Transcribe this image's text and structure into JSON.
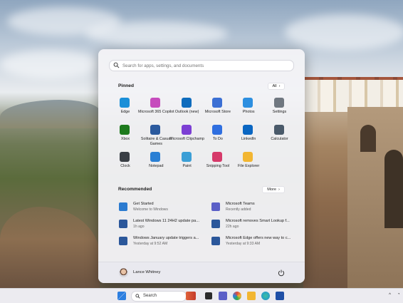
{
  "search": {
    "placeholder": "Search for apps, settings, and documents"
  },
  "pinned": {
    "title": "Pinned",
    "all_label": "All",
    "apps": [
      {
        "label": "Edge",
        "icon": "edge-icon",
        "color": "#1a8fd8"
      },
      {
        "label": "Microsoft 365 Copilot",
        "icon": "m365-copilot-icon",
        "color": "#c64bbd"
      },
      {
        "label": "Outlook (new)",
        "icon": "outlook-icon",
        "color": "#0f6cbd"
      },
      {
        "label": "Microsoft Store",
        "icon": "store-icon",
        "color": "#3b6fd4"
      },
      {
        "label": "Photos",
        "icon": "photos-icon",
        "color": "#2d8fe0"
      },
      {
        "label": "Settings",
        "icon": "settings-icon",
        "color": "#6f7780"
      },
      {
        "label": "Xbox",
        "icon": "xbox-icon",
        "color": "#1d7a1d"
      },
      {
        "label": "Solitaire & Casual Games",
        "icon": "solitaire-icon",
        "color": "#2b5a9e"
      },
      {
        "label": "Microsoft Clipchamp",
        "icon": "clipchamp-icon",
        "color": "#7c3fd4"
      },
      {
        "label": "To Do",
        "icon": "todo-icon",
        "color": "#2f6fe0"
      },
      {
        "label": "LinkedIn",
        "icon": "linkedin-icon",
        "color": "#0a66c2"
      },
      {
        "label": "Calculator",
        "icon": "calculator-icon",
        "color": "#4a5a6a"
      },
      {
        "label": "Clock",
        "icon": "clock-icon",
        "color": "#3a3f45"
      },
      {
        "label": "Notepad",
        "icon": "notepad-icon",
        "color": "#2a7fd4"
      },
      {
        "label": "Paint",
        "icon": "paint-icon",
        "color": "#3b9fd6"
      },
      {
        "label": "Snipping Tool",
        "icon": "snipping-tool-icon",
        "color": "#d63a6a"
      },
      {
        "label": "File Explorer",
        "icon": "file-explorer-icon",
        "color": "#f2b632"
      }
    ]
  },
  "recommended": {
    "title": "Recommended",
    "more_label": "More",
    "items": [
      {
        "title": "Get Started",
        "subtitle": "Welcome to Windows",
        "icon": "get-started-icon",
        "color": "#2b7bd0"
      },
      {
        "title": "Microsoft Teams",
        "subtitle": "Recently added",
        "icon": "teams-icon",
        "color": "#5b5fc7"
      },
      {
        "title": "Latest Windows 11 24H2 update pa...",
        "subtitle": "1h ago",
        "icon": "word-doc-icon",
        "color": "#2b579a"
      },
      {
        "title": "Microsoft removes Smart Lookup f...",
        "subtitle": "22h ago",
        "icon": "word-doc-icon",
        "color": "#2b579a"
      },
      {
        "title": "Windows January update triggers a...",
        "subtitle": "Yesterday at 9:52 AM",
        "icon": "word-doc-icon",
        "color": "#2b579a"
      },
      {
        "title": "Microsoft Edge offers new way to c...",
        "subtitle": "Yesterday at 9:33 AM",
        "icon": "word-doc-icon",
        "color": "#2b579a"
      }
    ]
  },
  "user": {
    "name": "Lance Whitney"
  },
  "taskbar": {
    "search_label": "Search"
  }
}
